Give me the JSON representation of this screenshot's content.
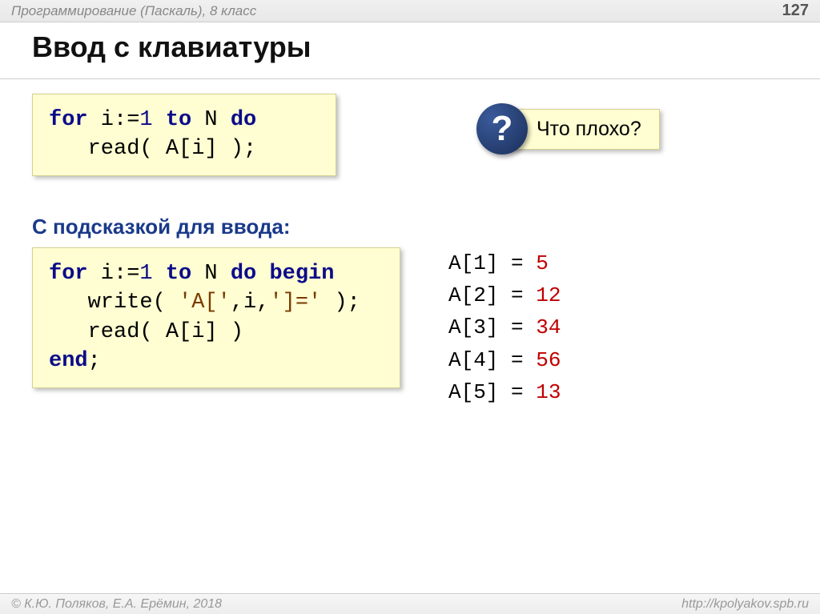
{
  "header": {
    "subject": "Программирование (Паскаль), 8 класс",
    "page": "127"
  },
  "title": "Ввод с клавиатуры",
  "code1": {
    "l1_a": "for",
    "l1_b": " i:=",
    "l1_c": "1",
    "l1_d": " to",
    "l1_e": " N ",
    "l1_f": "do",
    "l2_a": "   read( A[i] );"
  },
  "question": {
    "mark": "?",
    "text": "Что плохо?"
  },
  "subtitle": "С подсказкой для ввода:",
  "code2": {
    "l1_a": "for",
    "l1_b": " i:=",
    "l1_c": "1",
    "l1_d": " to",
    "l1_e": " N ",
    "l1_f": "do",
    "l1_g": " ",
    "l1_h": "begin",
    "l2_a": "   write( ",
    "l2_b": "'A['",
    "l2_c": ",i,",
    "l2_d": "']='",
    "l2_e": " );",
    "l3_a": "   read( A[i] )",
    "l4_a": "end",
    "l4_b": ";"
  },
  "output": [
    {
      "label": "A[1] = ",
      "value": "5"
    },
    {
      "label": "A[2] = ",
      "value": "12"
    },
    {
      "label": "A[3] = ",
      "value": "34"
    },
    {
      "label": "A[4] = ",
      "value": "56"
    },
    {
      "label": "A[5] = ",
      "value": "13"
    }
  ],
  "footer": {
    "authors": "© К.Ю. Поляков, Е.А. Ерёмин, 2018",
    "url": "http://kpolyakov.spb.ru"
  }
}
